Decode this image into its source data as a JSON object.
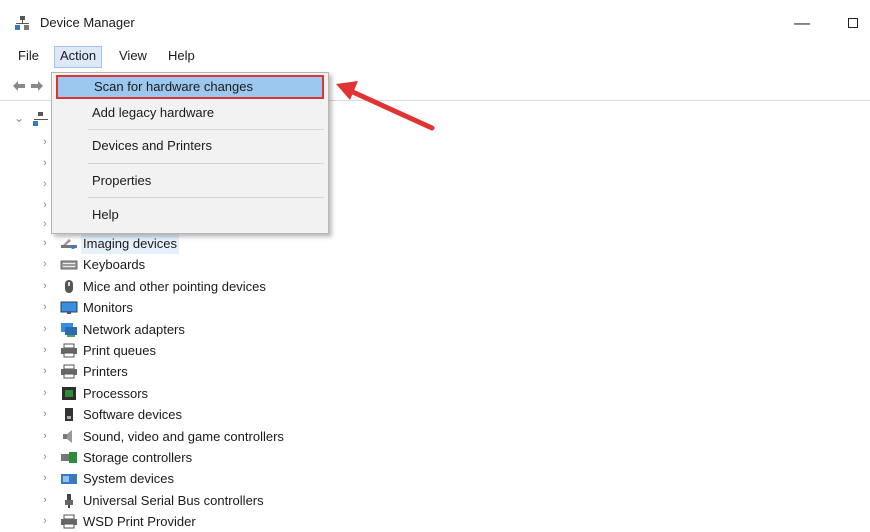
{
  "window": {
    "title": "Device Manager",
    "minimize_glyph": "—"
  },
  "menubar": {
    "file": "File",
    "action": "Action",
    "view": "View",
    "help": "Help"
  },
  "action_menu": {
    "items": [
      {
        "label": "Scan for hardware changes",
        "highlighted": true
      },
      {
        "label": "Add legacy hardware"
      },
      {
        "label": "Devices and Printers"
      },
      {
        "label": "Properties"
      },
      {
        "label": "Help"
      }
    ]
  },
  "tree": {
    "expand_glyph": "›",
    "devices": [
      {
        "label": "Imaging devices",
        "icon": "imaging-devices-icon",
        "selected": true
      },
      {
        "label": "Keyboards",
        "icon": "keyboard-icon"
      },
      {
        "label": "Mice and other pointing devices",
        "icon": "mouse-icon"
      },
      {
        "label": "Monitors",
        "icon": "monitor-icon"
      },
      {
        "label": "Network adapters",
        "icon": "network-adapter-icon"
      },
      {
        "label": "Print queues",
        "icon": "printer-icon"
      },
      {
        "label": "Printers",
        "icon": "printer-icon"
      },
      {
        "label": "Processors",
        "icon": "processor-icon"
      },
      {
        "label": "Software devices",
        "icon": "software-device-icon"
      },
      {
        "label": "Sound, video and game controllers",
        "icon": "speaker-icon"
      },
      {
        "label": "Storage controllers",
        "icon": "storage-controller-icon"
      },
      {
        "label": "System devices",
        "icon": "system-device-icon"
      },
      {
        "label": "Universal Serial Bus controllers",
        "icon": "usb-icon"
      },
      {
        "label": "WSD Print Provider",
        "icon": "printer-icon"
      }
    ]
  },
  "colors": {
    "highlight_border": "#e03434",
    "arrow": "#e03434",
    "selection": "#9cc8ef"
  }
}
